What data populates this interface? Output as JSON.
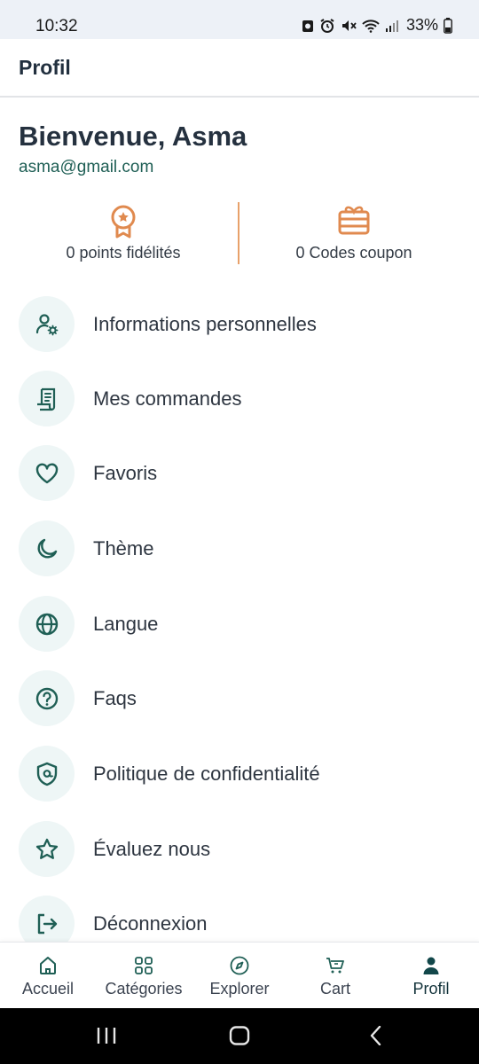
{
  "status_bar": {
    "time": "10:32",
    "battery": "33%"
  },
  "header": {
    "title": "Profil"
  },
  "profile": {
    "welcome": "Bienvenue, Asma",
    "email": "asma@gmail.com"
  },
  "stats": {
    "loyalty_points": "0 points fidélités",
    "coupon_codes": "0 Codes coupon"
  },
  "menu": {
    "items": [
      {
        "label": "Informations personnelles",
        "icon": "user-settings-icon"
      },
      {
        "label": "Mes commandes",
        "icon": "receipt-icon"
      },
      {
        "label": "Favoris",
        "icon": "heart-icon"
      },
      {
        "label": "Thème",
        "icon": "moon-icon"
      },
      {
        "label": "Langue",
        "icon": "globe-icon"
      },
      {
        "label": "Faqs",
        "icon": "help-circle-icon"
      },
      {
        "label": "Politique de confidentialité",
        "icon": "shield-icon"
      },
      {
        "label": "Évaluez nous",
        "icon": "star-icon"
      },
      {
        "label": "Déconnexion",
        "icon": "logout-icon"
      }
    ]
  },
  "bottom_nav": {
    "items": [
      {
        "label": "Accueil",
        "icon": "home-icon"
      },
      {
        "label": "Catégories",
        "icon": "grid-icon"
      },
      {
        "label": "Explorer",
        "icon": "compass-icon"
      },
      {
        "label": "Cart",
        "icon": "cart-icon"
      },
      {
        "label": "Profil",
        "icon": "user-icon"
      }
    ],
    "active": "Profil"
  },
  "colors": {
    "accent": "#1f5f55",
    "orange": "#e08a4f",
    "icon_bg": "#eef6f6",
    "text": "#25313f"
  }
}
